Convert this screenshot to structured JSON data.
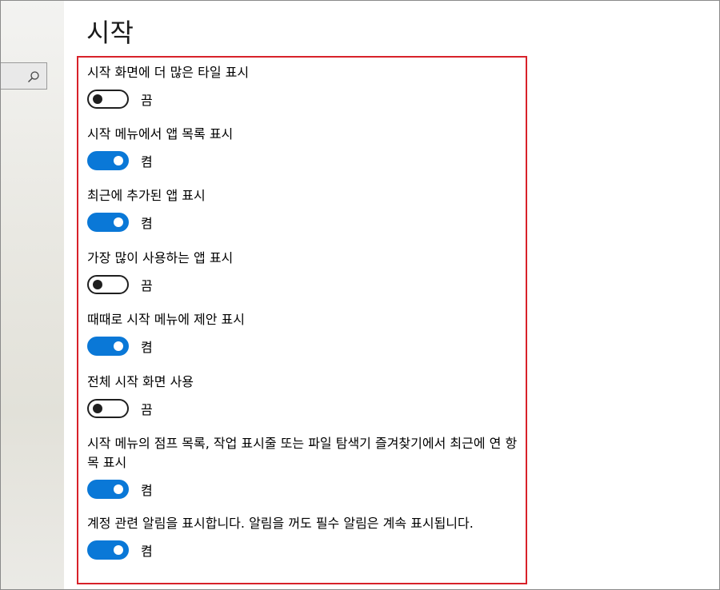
{
  "page": {
    "title": "시작"
  },
  "search": {
    "icon": "search-icon"
  },
  "accent": {
    "on_color": "#0a78d7",
    "highlight_border": "#d8222a"
  },
  "settings": [
    {
      "label": "시작 화면에 더 많은 타일 표시",
      "state": "끔",
      "on": false
    },
    {
      "label": "시작 메뉴에서 앱 목록 표시",
      "state": "켬",
      "on": true
    },
    {
      "label": "최근에 추가된 앱 표시",
      "state": "켬",
      "on": true
    },
    {
      "label": "가장 많이 사용하는 앱 표시",
      "state": "끔",
      "on": false
    },
    {
      "label": "때때로 시작 메뉴에 제안 표시",
      "state": "켬",
      "on": true
    },
    {
      "label": "전체 시작 화면 사용",
      "state": "끔",
      "on": false
    },
    {
      "label": "시작 메뉴의 점프 목록, 작업 표시줄 또는 파일 탐색기 즐겨찾기에서 최근에 연 항목 표시",
      "state": "켬",
      "on": true
    },
    {
      "label": "계정 관련 알림을 표시합니다. 알림을 꺼도 필수 알림은 계속 표시됩니다.",
      "state": "켬",
      "on": true
    }
  ]
}
